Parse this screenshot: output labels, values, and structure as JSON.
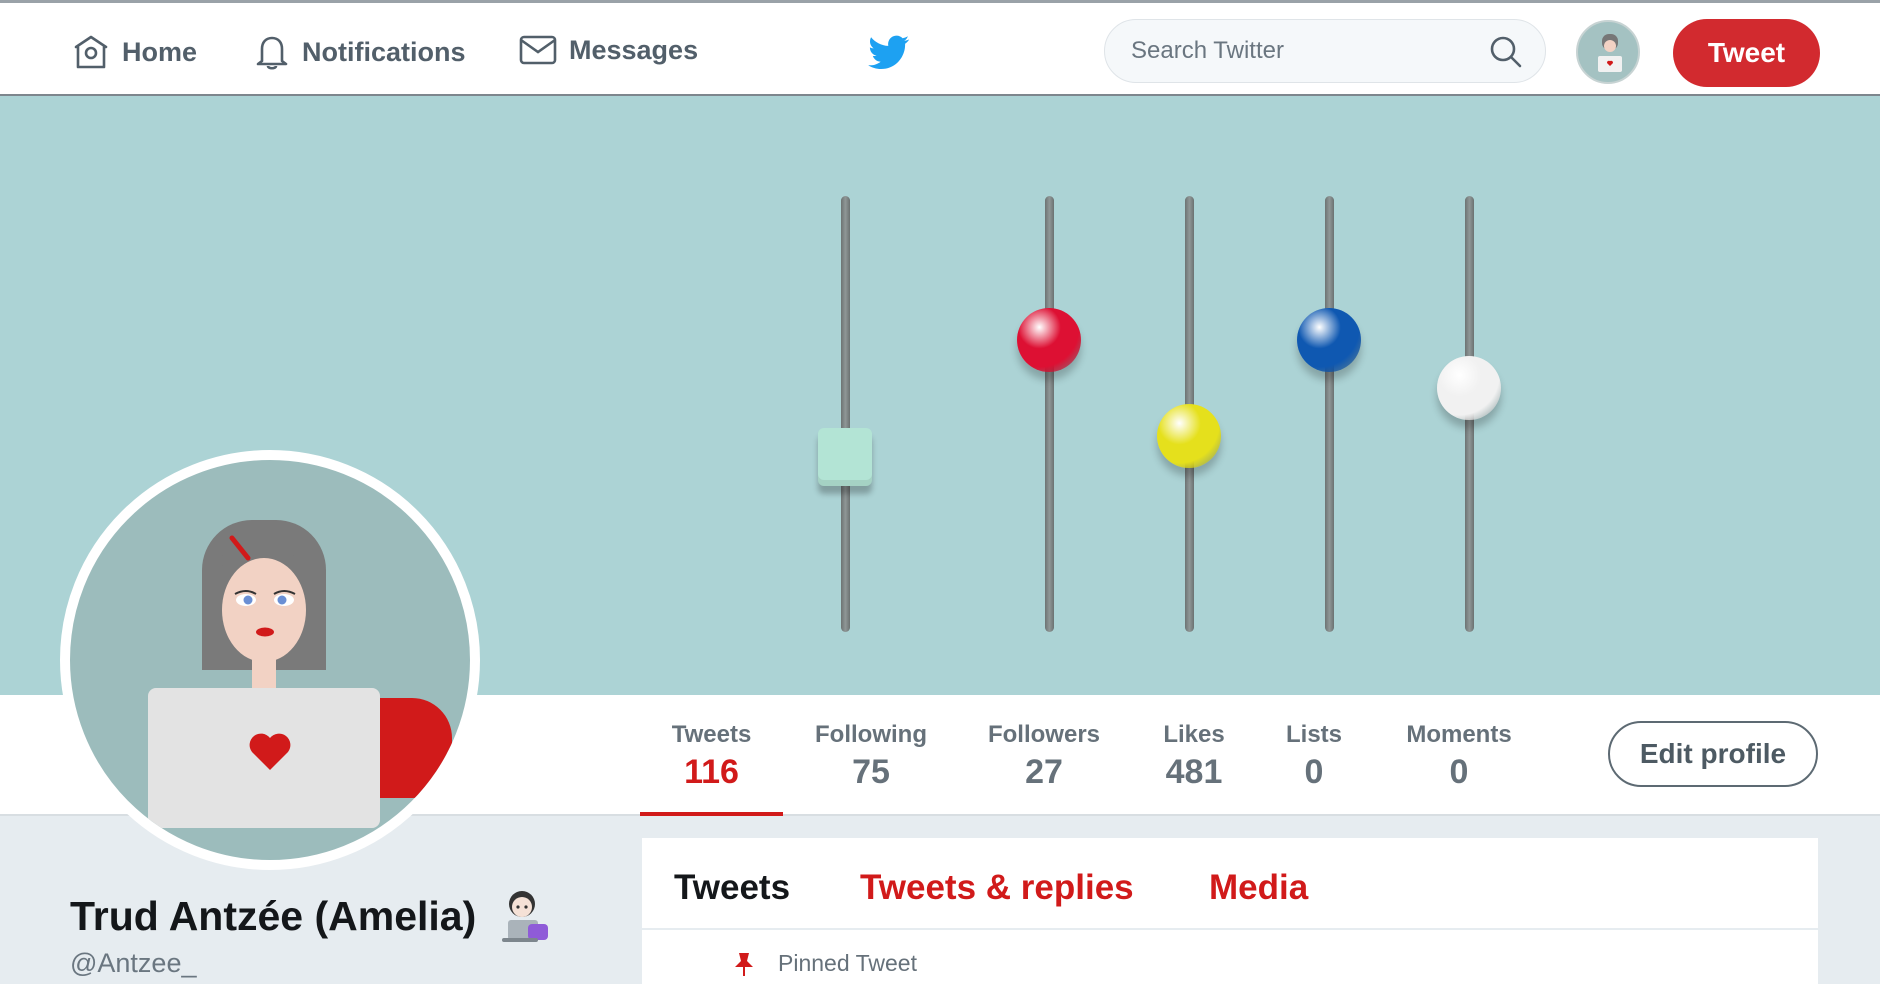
{
  "nav": {
    "home_label": "Home",
    "notifications_label": "Notifications",
    "messages_label": "Messages",
    "search_placeholder": "Search Twitter",
    "tweet_button": "Tweet"
  },
  "colors": {
    "accent": "#d22a2f",
    "twitter_blue": "#1da1f2",
    "banner": "#acd3d5"
  },
  "banner": {
    "sliders": [
      {
        "knob": "square",
        "color": "#b3e4d5",
        "level": 0.4
      },
      {
        "knob": "ball",
        "color": "#dd1033",
        "level": 0.67
      },
      {
        "knob": "ball",
        "color": "#e5e01c",
        "level": 0.45
      },
      {
        "knob": "ball",
        "color": "#0f58b1",
        "level": 0.67
      },
      {
        "knob": "ball",
        "color": "#f1f1f1",
        "level": 0.56
      }
    ]
  },
  "stats": [
    {
      "label": "Tweets",
      "value": "116"
    },
    {
      "label": "Following",
      "value": "75"
    },
    {
      "label": "Followers",
      "value": "27"
    },
    {
      "label": "Likes",
      "value": "481"
    },
    {
      "label": "Lists",
      "value": "0"
    },
    {
      "label": "Moments",
      "value": "0"
    }
  ],
  "edit_profile": "Edit profile",
  "profile": {
    "name": "Trud Antzée (Amelia)",
    "handle": "@Antzee_"
  },
  "timeline": {
    "tabs": [
      "Tweets",
      "Tweets & replies",
      "Media"
    ],
    "pinned_label": "Pinned Tweet"
  }
}
